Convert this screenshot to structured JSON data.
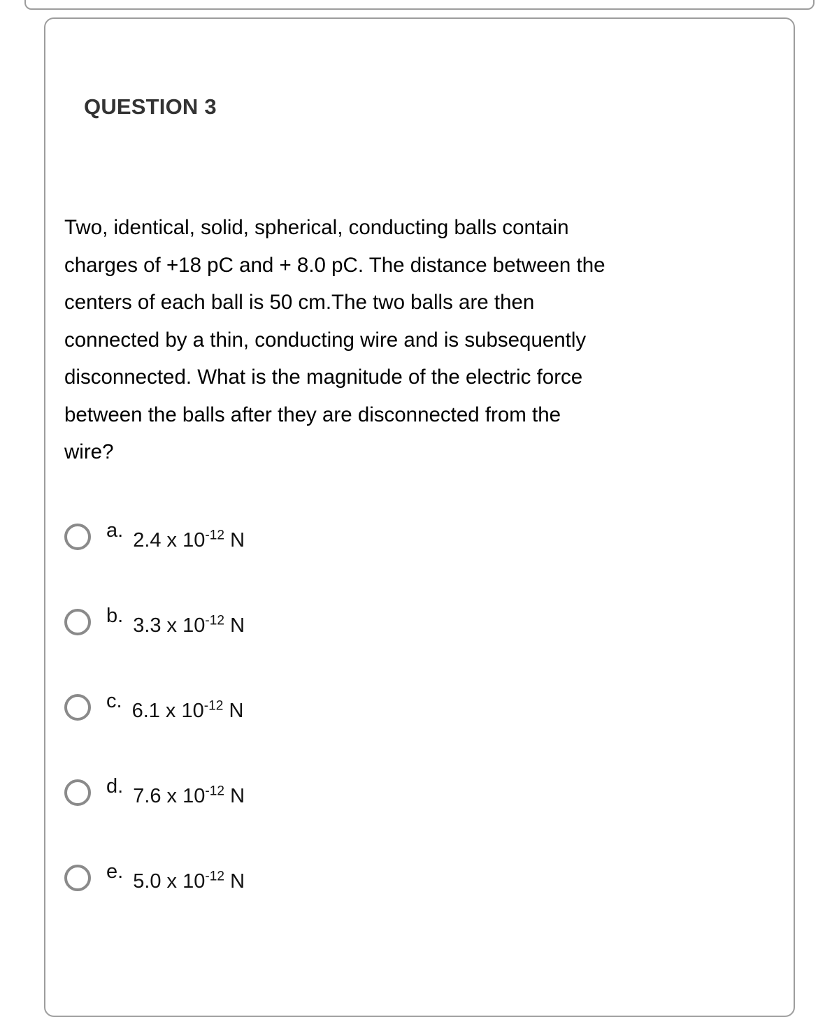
{
  "card": {
    "heading": "QUESTION 3",
    "question_lines": [
      "Two, identical, solid, spherical, conducting balls contain",
      "charges of +18 pC and + 8.0 pC. The distance between the",
      "centers of each ball is 50 cm.The two balls are then",
      "connected by a thin, conducting wire and is subsequently",
      "disconnected. What is the magnitude of the electric force",
      "between the balls after they are disconnected from the",
      "wire?"
    ],
    "question_text": "Two, identical, solid, spherical, conducting balls contain charges of +18 pC and + 8.0 pC. The distance between the centers of each ball is 50 cm.The two balls are then connected by a thin, conducting wire and is subsequently disconnected. What is the magnitude of the electric force between the balls after they are disconnected from the wire?",
    "options": [
      {
        "label": "a.",
        "mantissa": "2.4 x 10",
        "exponent": "-12",
        "unit": "N",
        "selected": false
      },
      {
        "label": "b.",
        "mantissa": "3.3 x 10",
        "exponent": "-12",
        "unit": "N",
        "selected": false
      },
      {
        "label": "c.",
        "mantissa": "6.1 x 10",
        "exponent": "-12",
        "unit": "N",
        "selected": false
      },
      {
        "label": "d.",
        "mantissa": "7.6 x 10",
        "exponent": "-12",
        "unit": "N",
        "selected": false
      },
      {
        "label": "e.",
        "mantissa": "5.0 x 10",
        "exponent": "-12",
        "unit": "N",
        "selected": false
      }
    ]
  },
  "colors": {
    "heading": "#333333",
    "body_text": "#000000",
    "card_border": "#9d9d9d",
    "radio_border": "#8a8a8a",
    "background": "#ffffff"
  }
}
